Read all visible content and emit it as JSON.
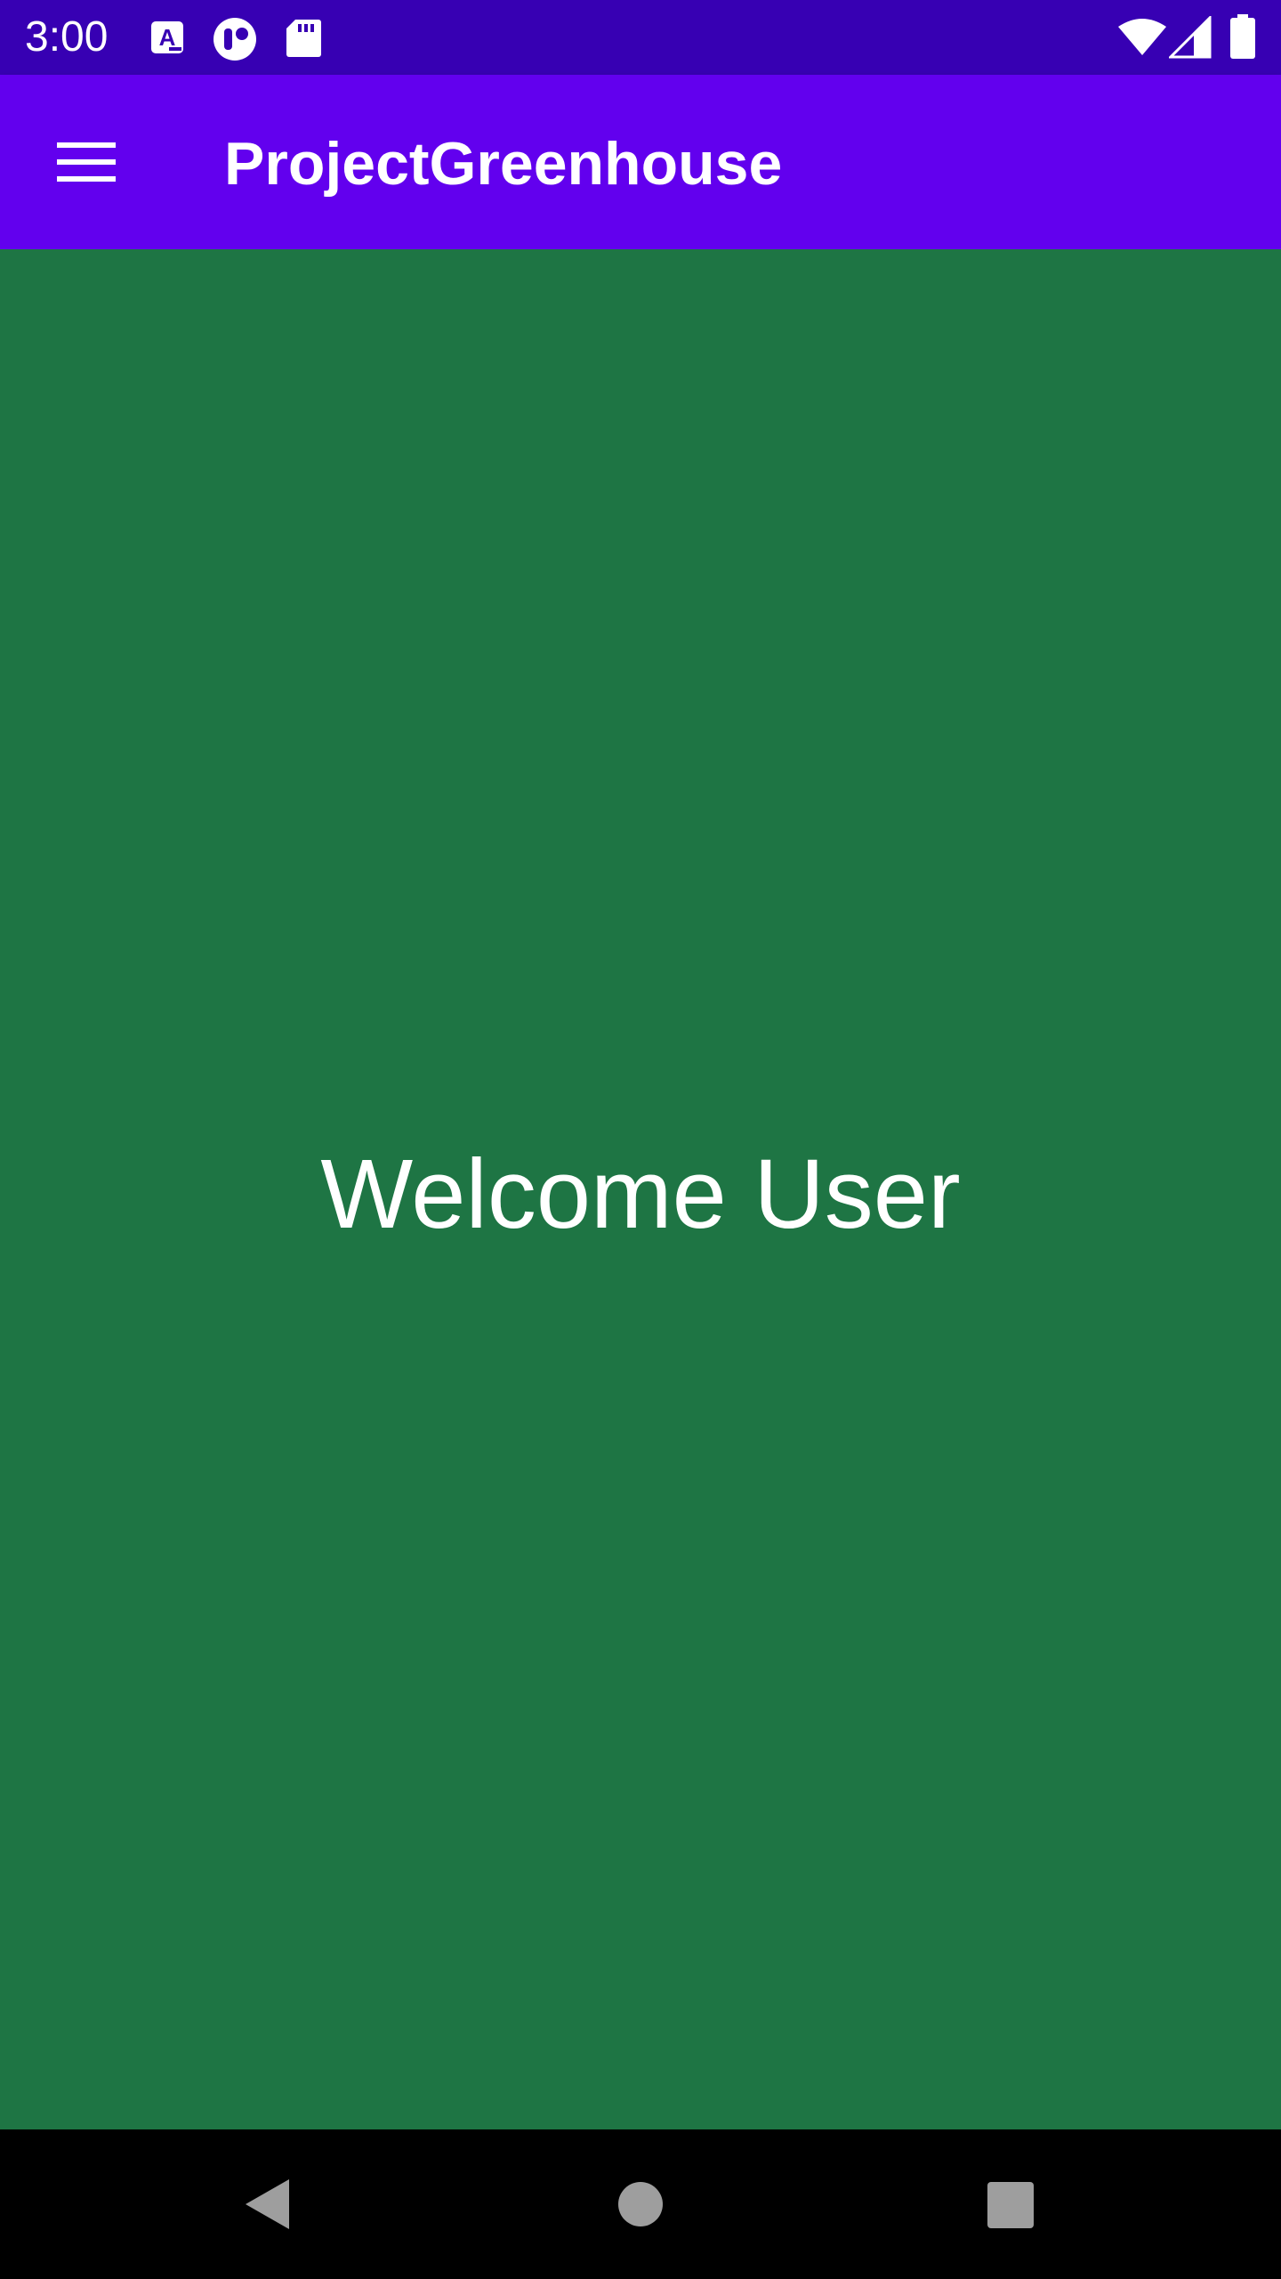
{
  "status_bar": {
    "time": "3:00",
    "background": "#3700b3",
    "left_icons": [
      "text-notification-icon",
      "sim-notification-icon",
      "sd-card-icon"
    ],
    "right_icons": [
      "wifi-icon",
      "cellular-signal-icon",
      "battery-icon"
    ]
  },
  "app_bar": {
    "title": "ProjectGreenhouse",
    "menu_icon": "hamburger-menu-icon",
    "background": "#6200ee"
  },
  "main": {
    "welcome_text": "Welcome User",
    "background": "#1e7544"
  },
  "nav_bar": {
    "buttons": [
      "back-icon",
      "home-icon",
      "recents-icon"
    ],
    "icon_color": "#9e9e9e"
  }
}
